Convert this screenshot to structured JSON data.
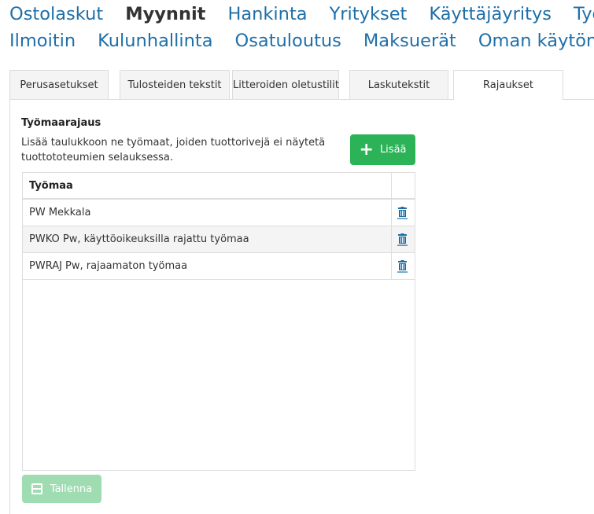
{
  "nav": {
    "row1": [
      "Ostolaskut",
      "Myynnit",
      "Hankinta",
      "Yritykset",
      "Käyttäjäyritys",
      "Työaik"
    ],
    "row2": [
      "Ilmoitin",
      "Kulunhallinta",
      "Osatuloutus",
      "Maksuerät",
      "Oman käytön A"
    ],
    "active": "Myynnit"
  },
  "tabs": [
    "Perusasetukset",
    "Tulosteiden tekstit",
    "Litteroiden oletustilit",
    "Laskutekstit",
    "Rajaukset"
  ],
  "active_tab": "Rajaukset",
  "section": {
    "title": "Työmaarajaus",
    "description": "Lisää taulukkoon ne työmaat, joiden tuottorivejä ei näytetä tuottototeumien selauksessa."
  },
  "add_button": {
    "label": "Lisää",
    "icon": "plus-icon"
  },
  "table": {
    "header": "Työmaa",
    "rows": [
      "PW Mekkala",
      "PWKO Pw, käyttöoikeuksilla rajattu työmaa",
      "PWRAJ Pw, rajaamaton työmaa"
    ],
    "row_action_icon": "trash-icon"
  },
  "save_button": {
    "label": "Tallenna",
    "icon": "save-icon"
  },
  "colors": {
    "link": "#1f6fa8",
    "accent_green": "#2db357",
    "disabled_green": "#9fdcb2"
  }
}
